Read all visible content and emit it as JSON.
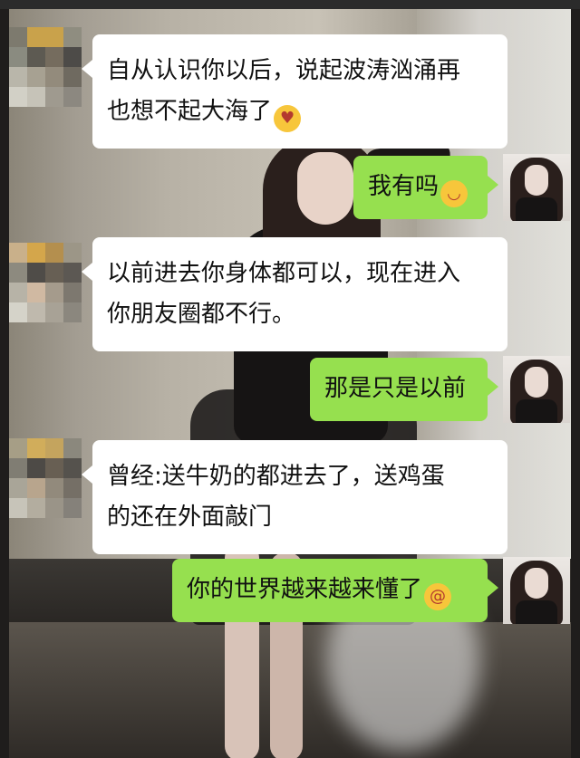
{
  "conversation": {
    "messages": [
      {
        "side": "left",
        "lines": [
          "自从认识你以后，说起波涛汹涌再",
          "也想不起大海了"
        ],
        "emoji": "heart-eyes-emoji"
      },
      {
        "side": "right",
        "lines": [
          "我有吗"
        ],
        "emoji": "smug-emoji"
      },
      {
        "side": "left",
        "lines": [
          "以前进去你身体都可以，现在进入",
          "你朋友圈都不行。"
        ]
      },
      {
        "side": "right",
        "lines": [
          "那是只是以前"
        ]
      },
      {
        "side": "left",
        "lines": [
          "曾经:送牛奶的都进去了，送鸡蛋",
          "的还在外面敲门"
        ]
      },
      {
        "side": "right",
        "lines": [
          "你的世界越来越来懂了"
        ],
        "emoji": "dizzy-face-emoji"
      }
    ]
  },
  "colors": {
    "sent_bubble": "#96e04f",
    "received_bubble": "#ffffff",
    "text": "#111111",
    "emoji_yellow": "#f7c63b"
  },
  "emoji_glyphs": {
    "heart": "♥",
    "smug": "◡",
    "dizzy": "@"
  }
}
